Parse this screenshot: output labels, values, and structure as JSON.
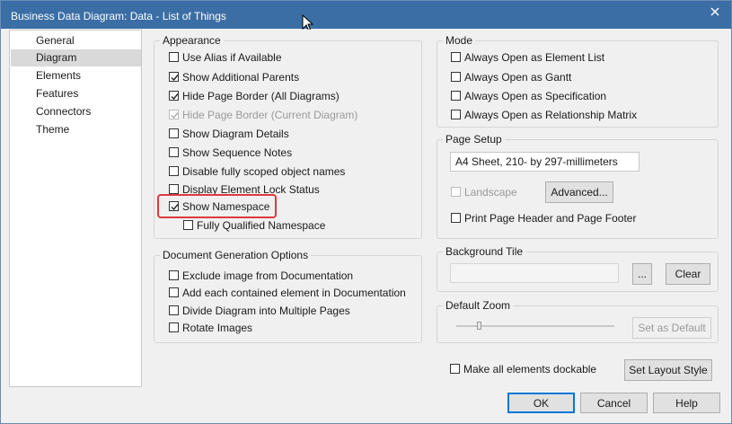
{
  "window": {
    "title": "Business Data Diagram: Data - List of Things"
  },
  "nav": {
    "items": [
      {
        "label": "General"
      },
      {
        "label": "Diagram"
      },
      {
        "label": "Elements"
      },
      {
        "label": "Features"
      },
      {
        "label": "Connectors"
      },
      {
        "label": "Theme"
      }
    ],
    "selected": "Diagram"
  },
  "appearance": {
    "title": "Appearance",
    "options": [
      {
        "label": "Use Alias if Available",
        "checked": false,
        "enabled": true
      },
      {
        "label": "Show Additional Parents",
        "checked": true,
        "enabled": true
      },
      {
        "label": "Hide Page Border (All Diagrams)",
        "checked": true,
        "enabled": true
      },
      {
        "label": "Hide Page Border (Current Diagram)",
        "checked": true,
        "enabled": false
      },
      {
        "label": "Show Diagram Details",
        "checked": false,
        "enabled": true
      },
      {
        "label": "Show Sequence Notes",
        "checked": false,
        "enabled": true
      },
      {
        "label": "Disable fully scoped object names",
        "checked": false,
        "enabled": true
      },
      {
        "label": "Display Element Lock Status",
        "checked": false,
        "enabled": true
      },
      {
        "label": "Show Namespace",
        "checked": true,
        "enabled": true
      },
      {
        "label": "Fully Qualified Namespace",
        "checked": false,
        "enabled": true
      }
    ]
  },
  "docgen": {
    "title": "Document Generation Options",
    "options": [
      {
        "label": "Exclude image from Documentation",
        "checked": false
      },
      {
        "label": "Add each contained element in Documentation",
        "checked": false
      },
      {
        "label": "Divide Diagram into Multiple Pages",
        "checked": false
      },
      {
        "label": "Rotate Images",
        "checked": false
      }
    ]
  },
  "mode": {
    "title": "Mode",
    "options": [
      {
        "label": "Always Open as Element List",
        "checked": false
      },
      {
        "label": "Always Open as Gantt",
        "checked": false
      },
      {
        "label": "Always Open as Specification",
        "checked": false
      },
      {
        "label": "Always Open as Relationship Matrix",
        "checked": false
      }
    ]
  },
  "page_setup": {
    "title": "Page Setup",
    "paper": "A4 Sheet, 210- by 297-millimeters",
    "landscape_label": "Landscape",
    "landscape_checked": false,
    "advanced_label": "Advanced...",
    "print_header_label": "Print Page Header and Page Footer",
    "print_header_checked": false
  },
  "background_tile": {
    "title": "Background Tile",
    "path": "",
    "browse_label": "...",
    "clear_label": "Clear"
  },
  "default_zoom": {
    "title": "Default Zoom",
    "level": 0.15,
    "set_default_label": "Set as Default"
  },
  "dockable": {
    "label": "Make all elements dockable",
    "checked": false
  },
  "set_layout_style_label": "Set Layout Style",
  "footer": {
    "ok_label": "OK",
    "cancel_label": "Cancel",
    "help_label": "Help"
  }
}
